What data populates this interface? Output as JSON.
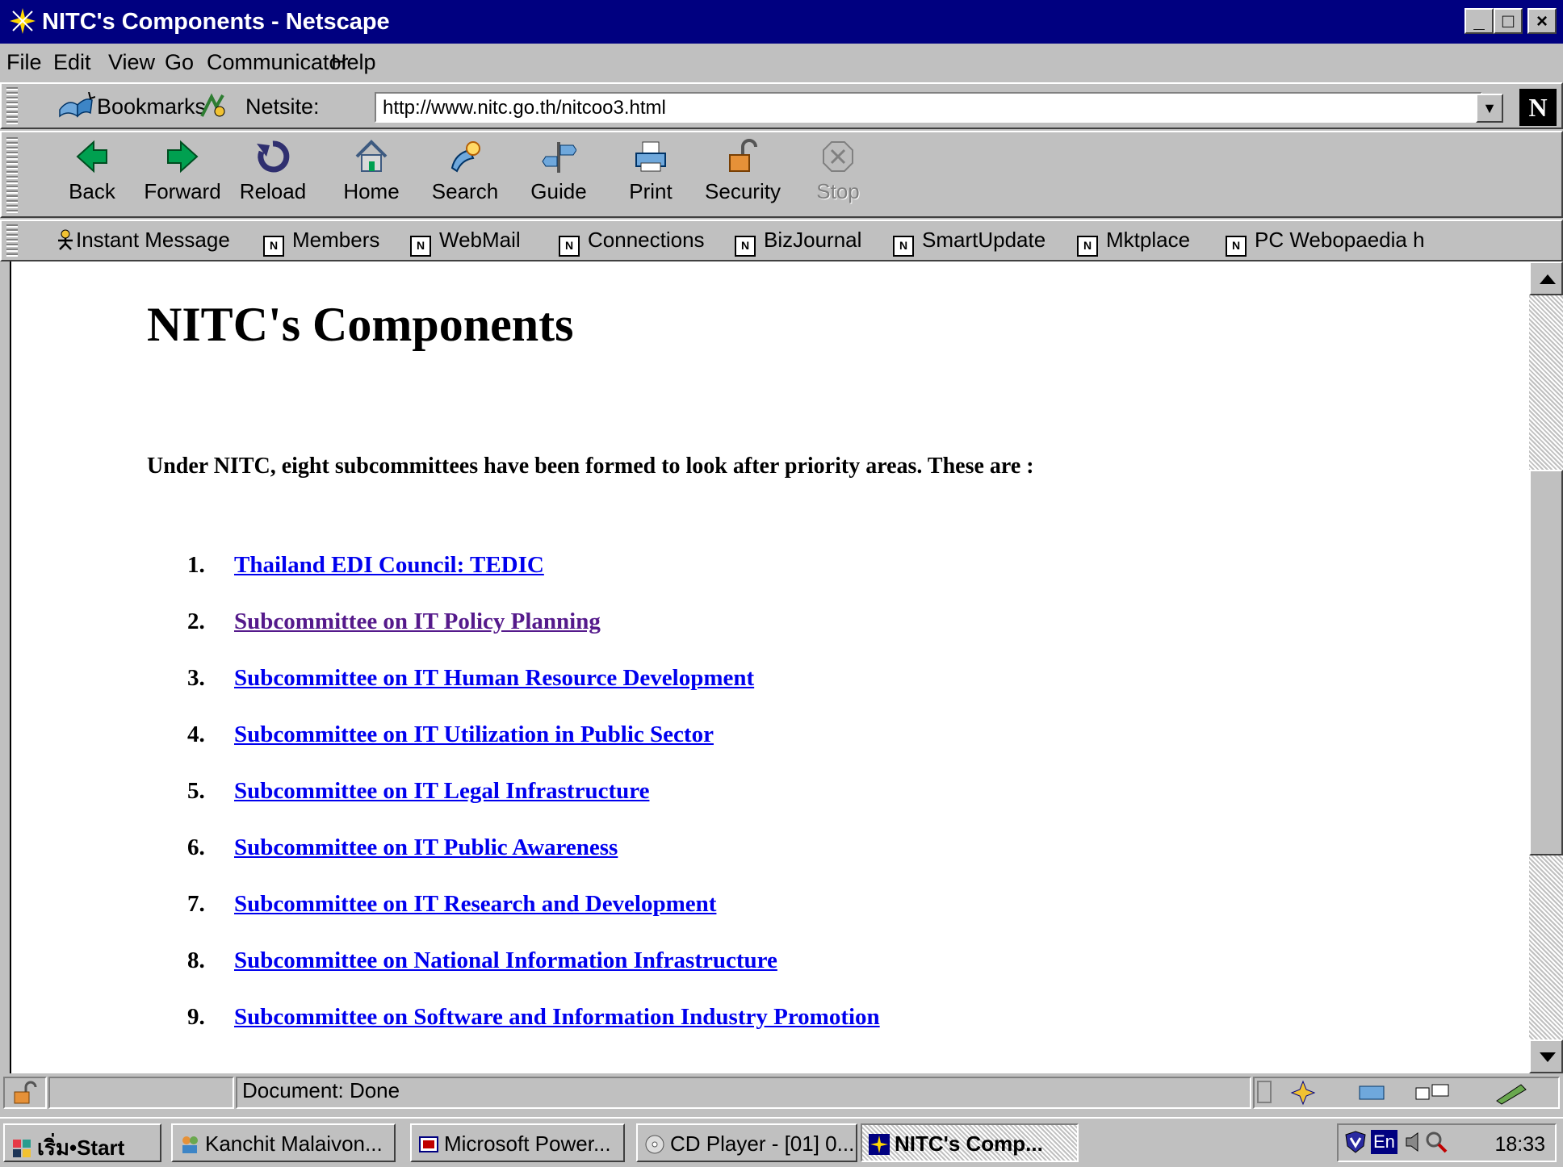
{
  "window": {
    "title": "NITC's Components - Netscape",
    "controls": {
      "minimize": "_",
      "maximize": "□",
      "close": "×"
    }
  },
  "menu": [
    "File",
    "Edit",
    "View",
    "Go",
    "Communicator",
    "Help"
  ],
  "location_bar": {
    "bookmarks_label": "Bookmarks",
    "netsite_label": "Netsite:",
    "url": "http://www.nitc.go.th/nitcoo3.html",
    "logo_letter": "N"
  },
  "nav_buttons": [
    "Back",
    "Forward",
    "Reload",
    "Home",
    "Search",
    "Guide",
    "Print",
    "Security",
    "Stop"
  ],
  "personal_toolbar": [
    "Instant Message",
    "Members",
    "WebMail",
    "Connections",
    "BizJournal",
    "SmartUpdate",
    "Mktplace",
    "PC Webopaedia h"
  ],
  "page": {
    "heading": "NITC's Components",
    "intro": "Under NITC, eight subcommittees have been formed to look after priority areas. These are :",
    "items": [
      {
        "num": "1.",
        "text": "Thailand EDI Council: TEDIC",
        "visited": false
      },
      {
        "num": "2.",
        "text": "Subcommittee on IT Policy Planning",
        "visited": true
      },
      {
        "num": "3.",
        "text": "Subcommittee on IT Human Resource Development",
        "visited": false
      },
      {
        "num": "4.",
        "text": "Subcommittee on IT Utilization in Public Sector",
        "visited": false
      },
      {
        "num": "5.",
        "text": "Subcommittee on IT Legal Infrastructure",
        "visited": false
      },
      {
        "num": "6.",
        "text": "Subcommittee on IT Public Awareness",
        "visited": false
      },
      {
        "num": "7.",
        "text": "Subcommittee on IT Research and Development",
        "visited": false
      },
      {
        "num": "8.",
        "text": "Subcommittee on National Information Infrastructure",
        "visited": false
      },
      {
        "num": "9.",
        "text": "Subcommittee on Software and Information Industry Promotion",
        "visited": false
      }
    ],
    "link_color": "#0000ee",
    "visited_color": "#551a8b"
  },
  "status": {
    "text": "Document: Done"
  },
  "taskbar": {
    "start_label": "เริ่ม•Start",
    "tasks": [
      "Kanchit Malaivon...",
      "Microsoft Power...",
      "CD Player - [01] 0...",
      "NITC's Comp..."
    ],
    "tray_lang": "En",
    "clock": "18:33"
  }
}
